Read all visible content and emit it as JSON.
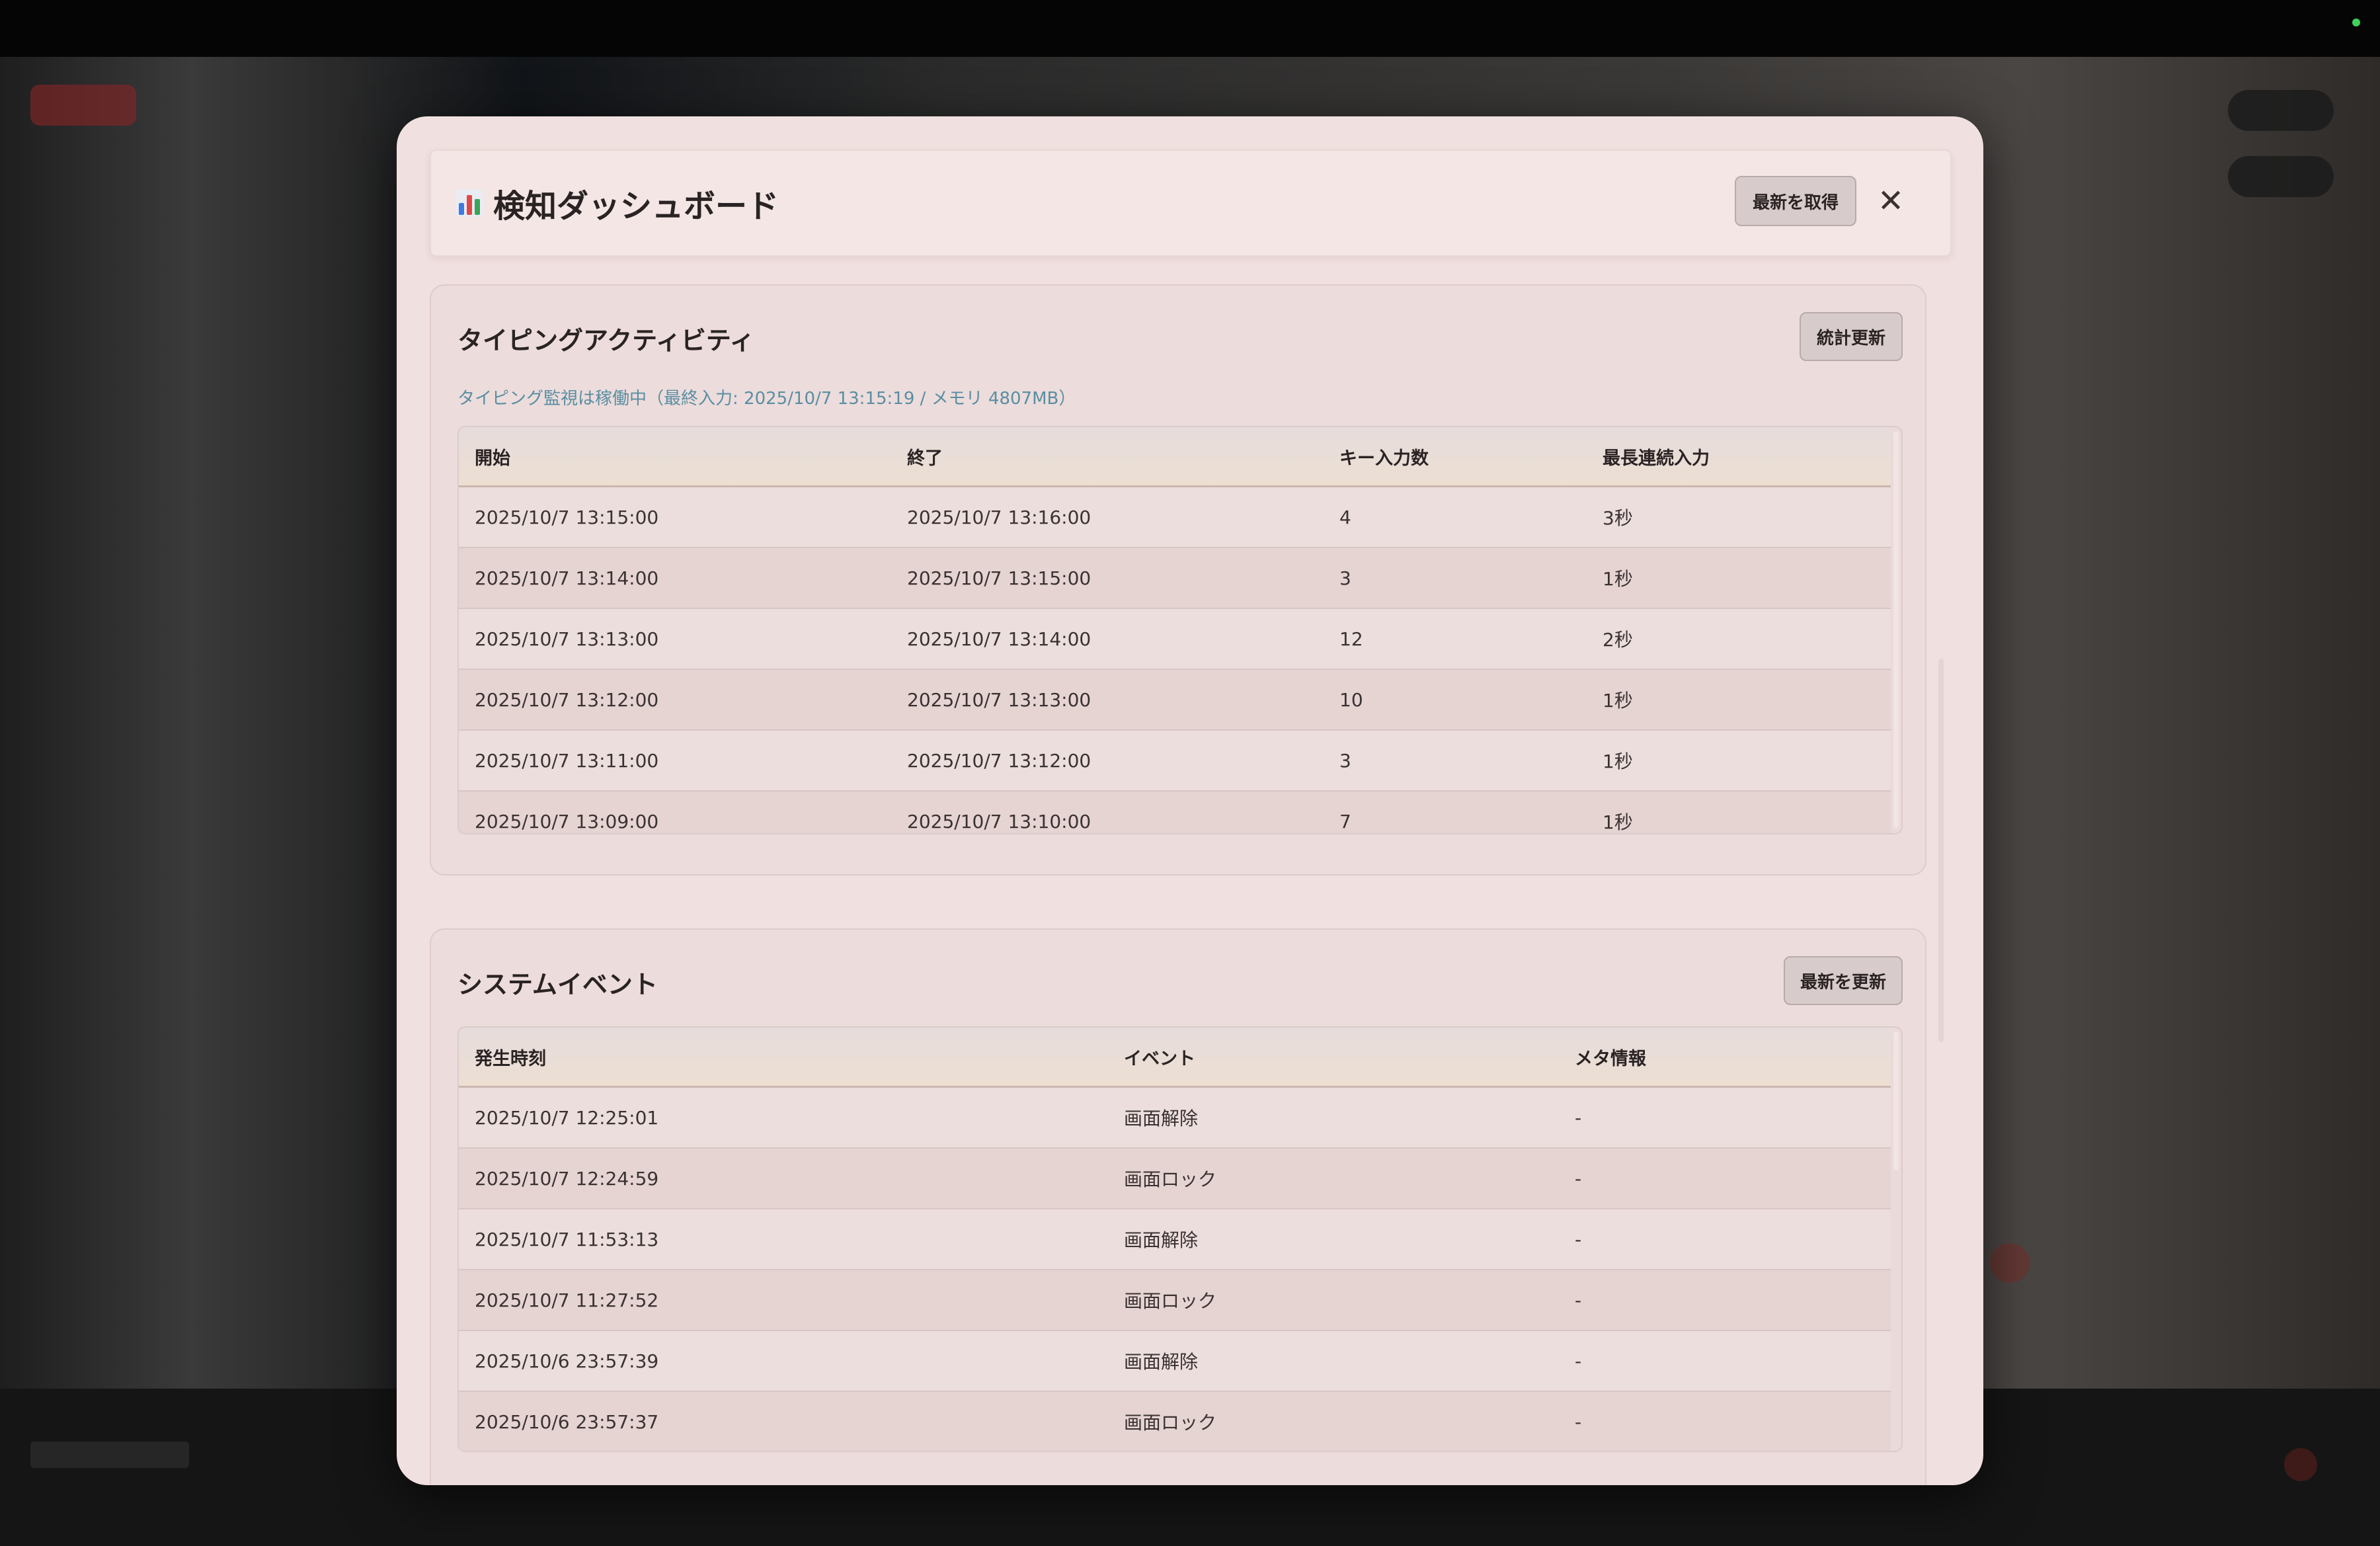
{
  "header": {
    "title": "検知ダッシュボード",
    "refresh_label": "最新を取得",
    "close_label": "✕"
  },
  "typing": {
    "title": "タイピングアクティビティ",
    "button_label": "統計更新",
    "status": "タイピング監視は稼働中（最終入力: 2025/10/7 13:15:19 / メモリ 4807MB）",
    "columns": [
      "開始",
      "終了",
      "キー入力数",
      "最長連続入力"
    ],
    "rows": [
      [
        "2025/10/7 13:15:00",
        "2025/10/7 13:16:00",
        "4",
        "3秒"
      ],
      [
        "2025/10/7 13:14:00",
        "2025/10/7 13:15:00",
        "3",
        "1秒"
      ],
      [
        "2025/10/7 13:13:00",
        "2025/10/7 13:14:00",
        "12",
        "2秒"
      ],
      [
        "2025/10/7 13:12:00",
        "2025/10/7 13:13:00",
        "10",
        "1秒"
      ],
      [
        "2025/10/7 13:11:00",
        "2025/10/7 13:12:00",
        "3",
        "1秒"
      ],
      [
        "2025/10/7 13:09:00",
        "2025/10/7 13:10:00",
        "7",
        "1秒"
      ]
    ]
  },
  "events": {
    "title": "システムイベント",
    "button_label": "最新を更新",
    "columns": [
      "発生時刻",
      "イベント",
      "メタ情報"
    ],
    "rows": [
      [
        "2025/10/7 12:25:01",
        "画面解除",
        "-"
      ],
      [
        "2025/10/7 12:24:59",
        "画面ロック",
        "-"
      ],
      [
        "2025/10/7 11:53:13",
        "画面解除",
        "-"
      ],
      [
        "2025/10/7 11:27:52",
        "画面ロック",
        "-"
      ],
      [
        "2025/10/6 23:57:39",
        "画面解除",
        "-"
      ],
      [
        "2025/10/6 23:57:37",
        "画面ロック",
        "-"
      ]
    ]
  },
  "icons": {
    "title_icon": "bar-chart-icon",
    "close_icon": "close-icon"
  },
  "colors": {
    "modal_bg": "#f0e0df",
    "status_text": "#5a8ea2",
    "button_bg": "#d8cbcb"
  }
}
